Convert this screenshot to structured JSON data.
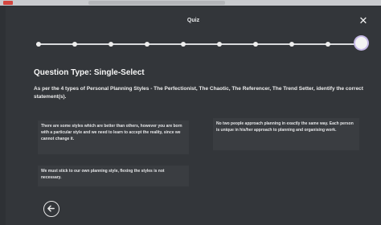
{
  "modal": {
    "title": "Quiz",
    "close_icon": "close-icon",
    "progress": {
      "steps": 10,
      "current_step": 10
    }
  },
  "question": {
    "type_label": "Question Type: Single-Select",
    "text": "As per the 4 types of Personal Planning Styles - The Perfectionist, The Chaotic, The Referencer, The Trend Setter, identify the correct statement(s).",
    "options": [
      {
        "text": "There are some styles which are better than others, however you are born with a particular style and we need to learn to accept the reality, since we cannot change it."
      },
      {
        "text": "No two people approach planning in exactly the same way. Each person is unique in his/her approach to planning and organising work."
      },
      {
        "text": "We must stick to our own planning style, flexing the styles is not necessary."
      }
    ]
  },
  "navigation": {
    "back_icon": "arrow-left-icon"
  },
  "colors": {
    "background": "#2e3135",
    "option_background": "#3a3d41",
    "accent_ring": "#c5b8e6"
  }
}
